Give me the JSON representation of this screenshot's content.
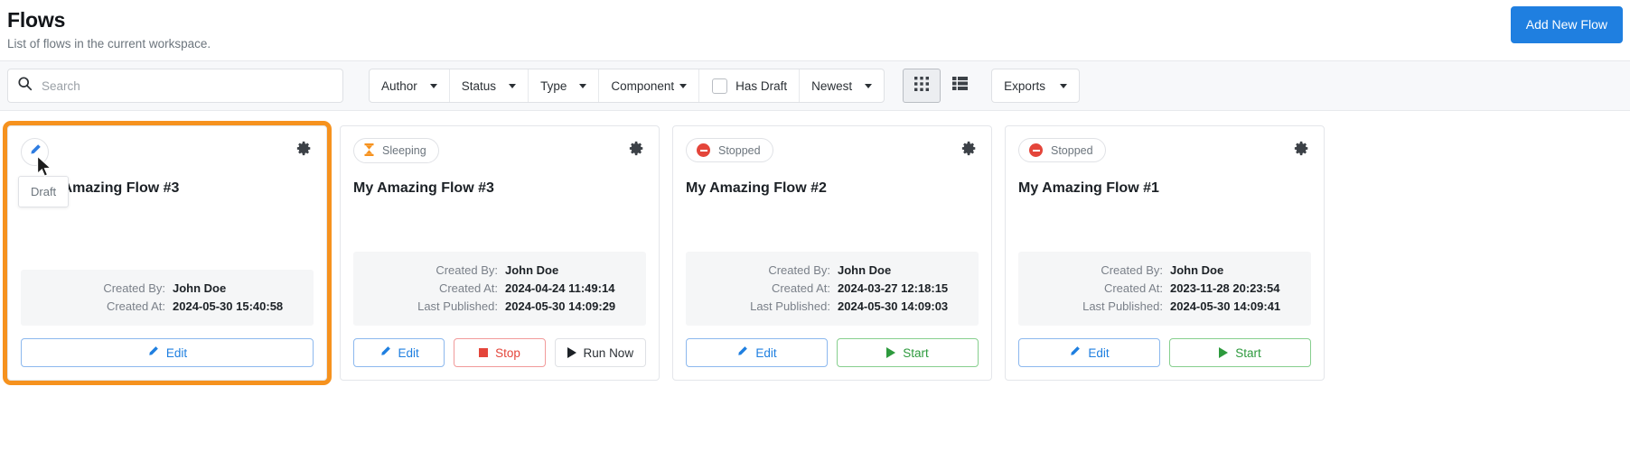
{
  "header": {
    "title": "Flows",
    "subtitle": "List of flows in the current workspace.",
    "add_button": "Add New Flow",
    "accent_color": "#1f7fe0"
  },
  "toolbar": {
    "search_placeholder": "Search",
    "search_value": "",
    "search_icon": "search-icon",
    "filters": [
      {
        "label": "Author",
        "icon": "chevron-down-icon"
      },
      {
        "label": "Status",
        "icon": "chevron-down-icon"
      },
      {
        "label": "Type",
        "icon": "chevron-down-icon"
      },
      {
        "label": "Component",
        "icon": "chevron-down-icon"
      }
    ],
    "has_draft": {
      "label": "Has Draft",
      "checked": false
    },
    "sort": {
      "label": "Newest",
      "icon": "chevron-down-icon"
    },
    "view_grid": {
      "name": "grid-view-icon",
      "active": true
    },
    "view_list": {
      "name": "list-view-icon",
      "active": false
    },
    "exports": {
      "label": "Exports",
      "icon": "chevron-down-icon"
    }
  },
  "cards": [
    {
      "highlighted": true,
      "badge_type": "draft",
      "badge_label": "Draft",
      "badge_icon": "pencil-icon",
      "tooltip": "Draft",
      "title": "of My Amazing Flow #3",
      "gear_icon": "gear-icon",
      "meta": [
        {
          "label": "Created By:",
          "value": "John Doe"
        },
        {
          "label": "Created At:",
          "value": "2024-05-30 15:40:58"
        }
      ],
      "actions": [
        {
          "label": "Edit",
          "kind": "edit",
          "icon": "pencil-icon",
          "full": true
        }
      ]
    },
    {
      "highlighted": false,
      "badge_type": "status",
      "badge_label": "Sleeping",
      "badge_icon": "hourglass-icon",
      "title": "My Amazing Flow #3",
      "gear_icon": "gear-icon",
      "meta": [
        {
          "label": "Created By:",
          "value": "John Doe"
        },
        {
          "label": "Created At:",
          "value": "2024-04-24 11:49:14"
        },
        {
          "label": "Last Published:",
          "value": "2024-05-30 14:09:29"
        }
      ],
      "actions": [
        {
          "label": "Edit",
          "kind": "edit",
          "icon": "pencil-icon"
        },
        {
          "label": "Stop",
          "kind": "stop",
          "icon": "stop-square-icon"
        },
        {
          "label": "Run Now",
          "kind": "run",
          "icon": "play-icon"
        }
      ]
    },
    {
      "highlighted": false,
      "badge_type": "status",
      "badge_label": "Stopped",
      "badge_icon": "stopped-circle-icon",
      "title": "My Amazing Flow #2",
      "gear_icon": "gear-icon",
      "meta": [
        {
          "label": "Created By:",
          "value": "John Doe"
        },
        {
          "label": "Created At:",
          "value": "2024-03-27 12:18:15"
        },
        {
          "label": "Last Published:",
          "value": "2024-05-30 14:09:03"
        }
      ],
      "actions": [
        {
          "label": "Edit",
          "kind": "edit",
          "icon": "pencil-icon"
        },
        {
          "label": "Start",
          "kind": "start",
          "icon": "play-icon"
        }
      ]
    },
    {
      "highlighted": false,
      "badge_type": "status",
      "badge_label": "Stopped",
      "badge_icon": "stopped-circle-icon",
      "title": "My Amazing Flow #1",
      "gear_icon": "gear-icon",
      "meta": [
        {
          "label": "Created By:",
          "value": "John Doe"
        },
        {
          "label": "Created At:",
          "value": "2023-11-28 20:23:54"
        },
        {
          "label": "Last Published:",
          "value": "2024-05-30 14:09:41"
        }
      ],
      "actions": [
        {
          "label": "Edit",
          "kind": "edit",
          "icon": "pencil-icon"
        },
        {
          "label": "Start",
          "kind": "start",
          "icon": "play-icon"
        }
      ]
    }
  ],
  "colors": {
    "highlight_outline": "#f6921e",
    "sleeping": "#f6921e",
    "stopped": "#e4453a",
    "start": "#2d9a3d",
    "edit": "#1f7fe0"
  }
}
